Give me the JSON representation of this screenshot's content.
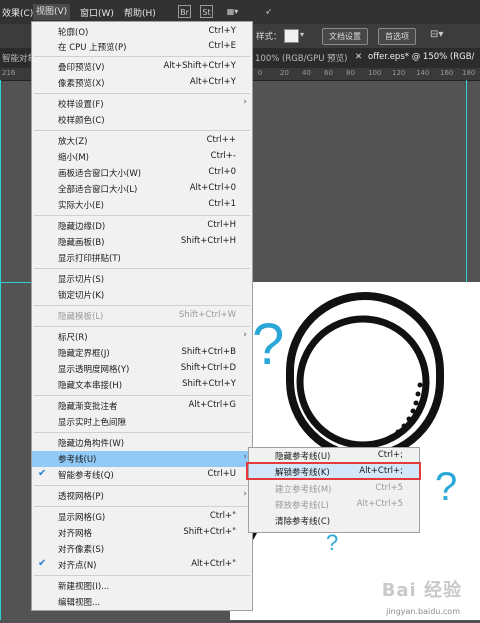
{
  "menubar": {
    "items": [
      "效果(C)",
      "视图(V)",
      "窗口(W)",
      "帮助(H)"
    ],
    "icons": [
      "bridge-icon",
      "stock-icon",
      "arrange-docs-icon",
      "gpu-rocket-icon"
    ]
  },
  "controlbar": {
    "style_label": "样式：",
    "doc_settings": "文档设置",
    "preferences": "首选项"
  },
  "tabs": {
    "left": "智能对象",
    "middle": "100% (RGB/GPU 预览)",
    "close": "✕",
    "active": "offer.eps* @ 150% (RGB/"
  },
  "ruler": [
    "216",
    "0",
    "20",
    "40",
    "60",
    "80",
    "100",
    "120",
    "140",
    "160",
    "180"
  ],
  "menu": {
    "items": [
      {
        "label": "轮廓(O)",
        "shortcut": "Ctrl+Y"
      },
      {
        "label": "在 CPU 上预览(P)",
        "shortcut": "Ctrl+E"
      },
      {
        "label": "叠印预览(V)",
        "shortcut": "Alt+Shift+Ctrl+Y"
      },
      {
        "label": "像素预览(X)",
        "shortcut": "Alt+Ctrl+Y"
      },
      {
        "label": "校样设置(F)",
        "shortcut": ""
      },
      {
        "label": "校样颜色(C)",
        "shortcut": ""
      },
      {
        "label": "放大(Z)",
        "shortcut": "Ctrl++"
      },
      {
        "label": "缩小(M)",
        "shortcut": "Ctrl+-"
      },
      {
        "label": "画板适合窗口大小(W)",
        "shortcut": "Ctrl+0"
      },
      {
        "label": "全部适合窗口大小(L)",
        "shortcut": "Alt+Ctrl+0"
      },
      {
        "label": "实际大小(E)",
        "shortcut": "Ctrl+1"
      },
      {
        "label": "隐藏边缘(D)",
        "shortcut": "Ctrl+H"
      },
      {
        "label": "隐藏画板(B)",
        "shortcut": "Shift+Ctrl+H"
      },
      {
        "label": "显示打印拼贴(T)",
        "shortcut": ""
      },
      {
        "label": "显示切片(S)",
        "shortcut": ""
      },
      {
        "label": "锁定切片(K)",
        "shortcut": ""
      },
      {
        "label": "隐藏模板(L)",
        "shortcut": "Shift+Ctrl+W"
      },
      {
        "label": "标尺(R)",
        "shortcut": ""
      },
      {
        "label": "隐藏定界框(J)",
        "shortcut": "Shift+Ctrl+B"
      },
      {
        "label": "显示透明度网格(Y)",
        "shortcut": "Shift+Ctrl+D"
      },
      {
        "label": "隐藏文本串接(H)",
        "shortcut": "Shift+Ctrl+Y"
      },
      {
        "label": "隐藏渐变批注者",
        "shortcut": "Alt+Ctrl+G"
      },
      {
        "label": "显示实时上色间隙",
        "shortcut": ""
      },
      {
        "label": "隐藏边角构件(W)",
        "shortcut": ""
      },
      {
        "label": "参考线(U)",
        "shortcut": ""
      },
      {
        "label": "智能参考线(Q)",
        "shortcut": "Ctrl+U"
      },
      {
        "label": "透视网格(P)",
        "shortcut": ""
      },
      {
        "label": "显示网格(G)",
        "shortcut": "Ctrl+\""
      },
      {
        "label": "对齐网格",
        "shortcut": "Shift+Ctrl+\""
      },
      {
        "label": "对齐像素(S)",
        "shortcut": ""
      },
      {
        "label": "对齐点(N)",
        "shortcut": "Alt+Ctrl+\""
      },
      {
        "label": "新建视图(I)...",
        "shortcut": ""
      },
      {
        "label": "编辑视图...",
        "shortcut": ""
      }
    ]
  },
  "submenu": {
    "items": [
      {
        "label": "隐藏参考线(U)",
        "shortcut": "Ctrl+;"
      },
      {
        "label": "解锁参考线(K)",
        "shortcut": "Alt+Ctrl+;"
      },
      {
        "label": "建立参考线(M)",
        "shortcut": "Ctrl+5"
      },
      {
        "label": "释放参考线(L)",
        "shortcut": "Alt+Ctrl+5"
      },
      {
        "label": "清除参考线(C)",
        "shortcut": ""
      }
    ]
  },
  "colors": {
    "menu_bg": "#f1f1f1",
    "highlight": "#91c9f7",
    "check": "#2a7fd4",
    "guide": "#2fd1d1",
    "question_mark": "#29a7d6",
    "red_box": "#e23b3b"
  },
  "watermark": {
    "logo": "Bai 经验",
    "url": "jingyan.baidu.com"
  }
}
